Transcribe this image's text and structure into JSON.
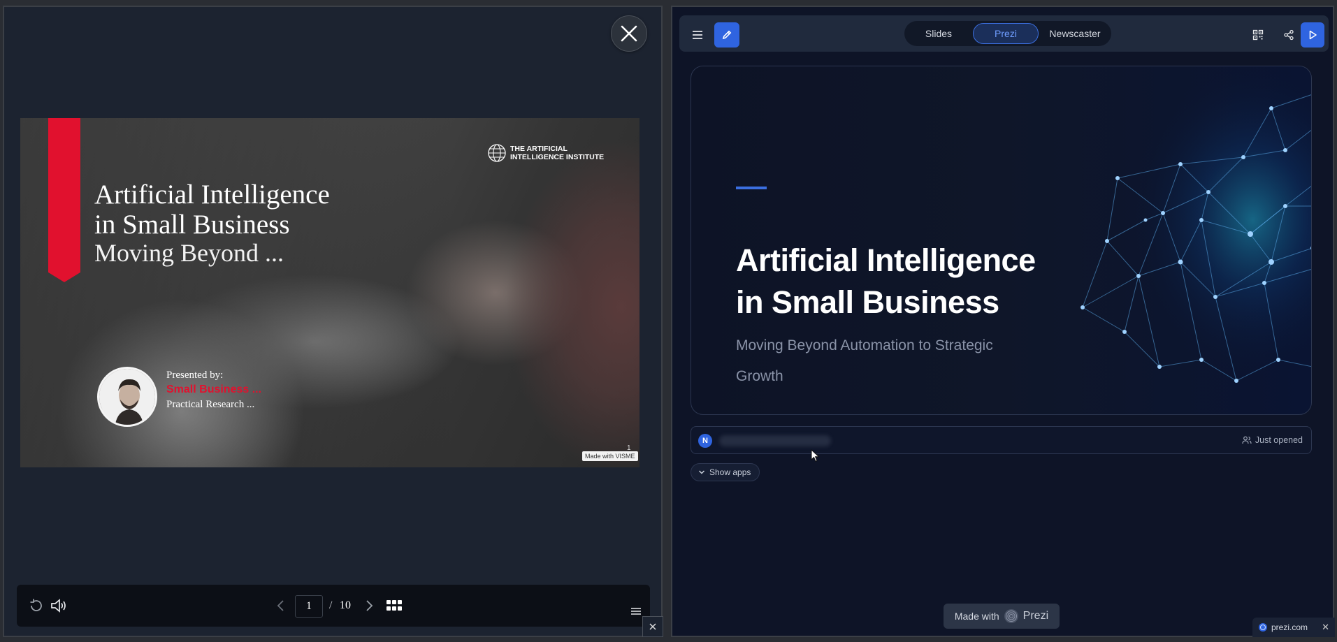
{
  "visme": {
    "slide": {
      "title_line1": "Artificial Intelligence",
      "title_line2": "in Small Business",
      "subtitle": "Moving Beyond ...",
      "institute_line1": "THE ARTIFICIAL",
      "institute_line2": "INTELLIGENCE INSTITUTE",
      "presented_by": "Presented by:",
      "presenter_name": "Small Business ...",
      "presenter_org": "Practical Research ...",
      "made_with": "Made with VISME",
      "slide_number": "1"
    },
    "controls": {
      "current_page": "1",
      "separator": "/",
      "total_pages": "10"
    },
    "colors": {
      "accent_red": "#e1112e",
      "panel_bg": "#1c2330"
    }
  },
  "prezi": {
    "tabs": [
      {
        "label": "Slides",
        "active": false
      },
      {
        "label": "Prezi",
        "active": true
      },
      {
        "label": "Newscaster",
        "active": false
      }
    ],
    "hero": {
      "title_line1": "Artificial Intelligence",
      "title_line2": "in Small Business",
      "subtitle": "Moving Beyond Automation to Strategic Growth"
    },
    "status": {
      "avatar_initial": "N",
      "state": "Just opened"
    },
    "show_apps": "Show apps",
    "made_with": "Made with",
    "brand": "Prezi",
    "domain": "prezi.com",
    "colors": {
      "accent_blue": "#3b6fe0",
      "bg": "#0e1427"
    }
  }
}
